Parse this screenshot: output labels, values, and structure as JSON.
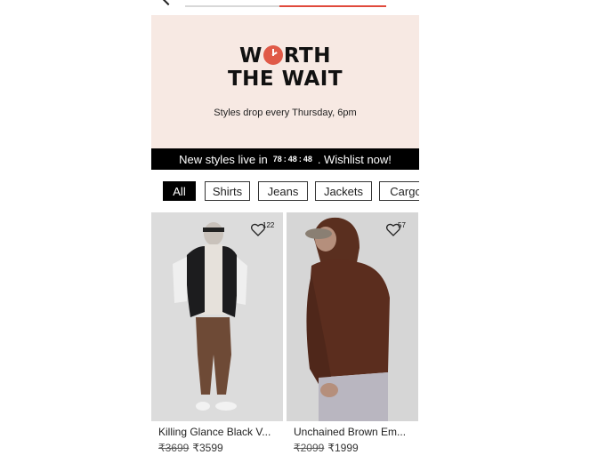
{
  "banner": {
    "headline_line1_pre": "W",
    "headline_line1_post": "RTH",
    "headline_line2": "THE WAIT",
    "subtitle": "Styles drop every Thursday, 6pm"
  },
  "countdown": {
    "prefix": "New styles live in",
    "hours": "78",
    "minutes": "48",
    "seconds": "48",
    "suffix": ". Wishlist now!"
  },
  "filters": [
    "All",
    "Shirts",
    "Jeans",
    "Jackets",
    "Cargo"
  ],
  "products": [
    {
      "name": "Killing Glance Black V...",
      "mrp": "₹3699",
      "price": "₹3599",
      "wishlist_count": "122"
    },
    {
      "name": "Unchained Brown Em...",
      "mrp": "₹2099",
      "price": "₹1999",
      "wishlist_count": "57"
    }
  ],
  "colors": {
    "accent": "#e04a3c",
    "banner_bg": "#f7e9e3"
  }
}
